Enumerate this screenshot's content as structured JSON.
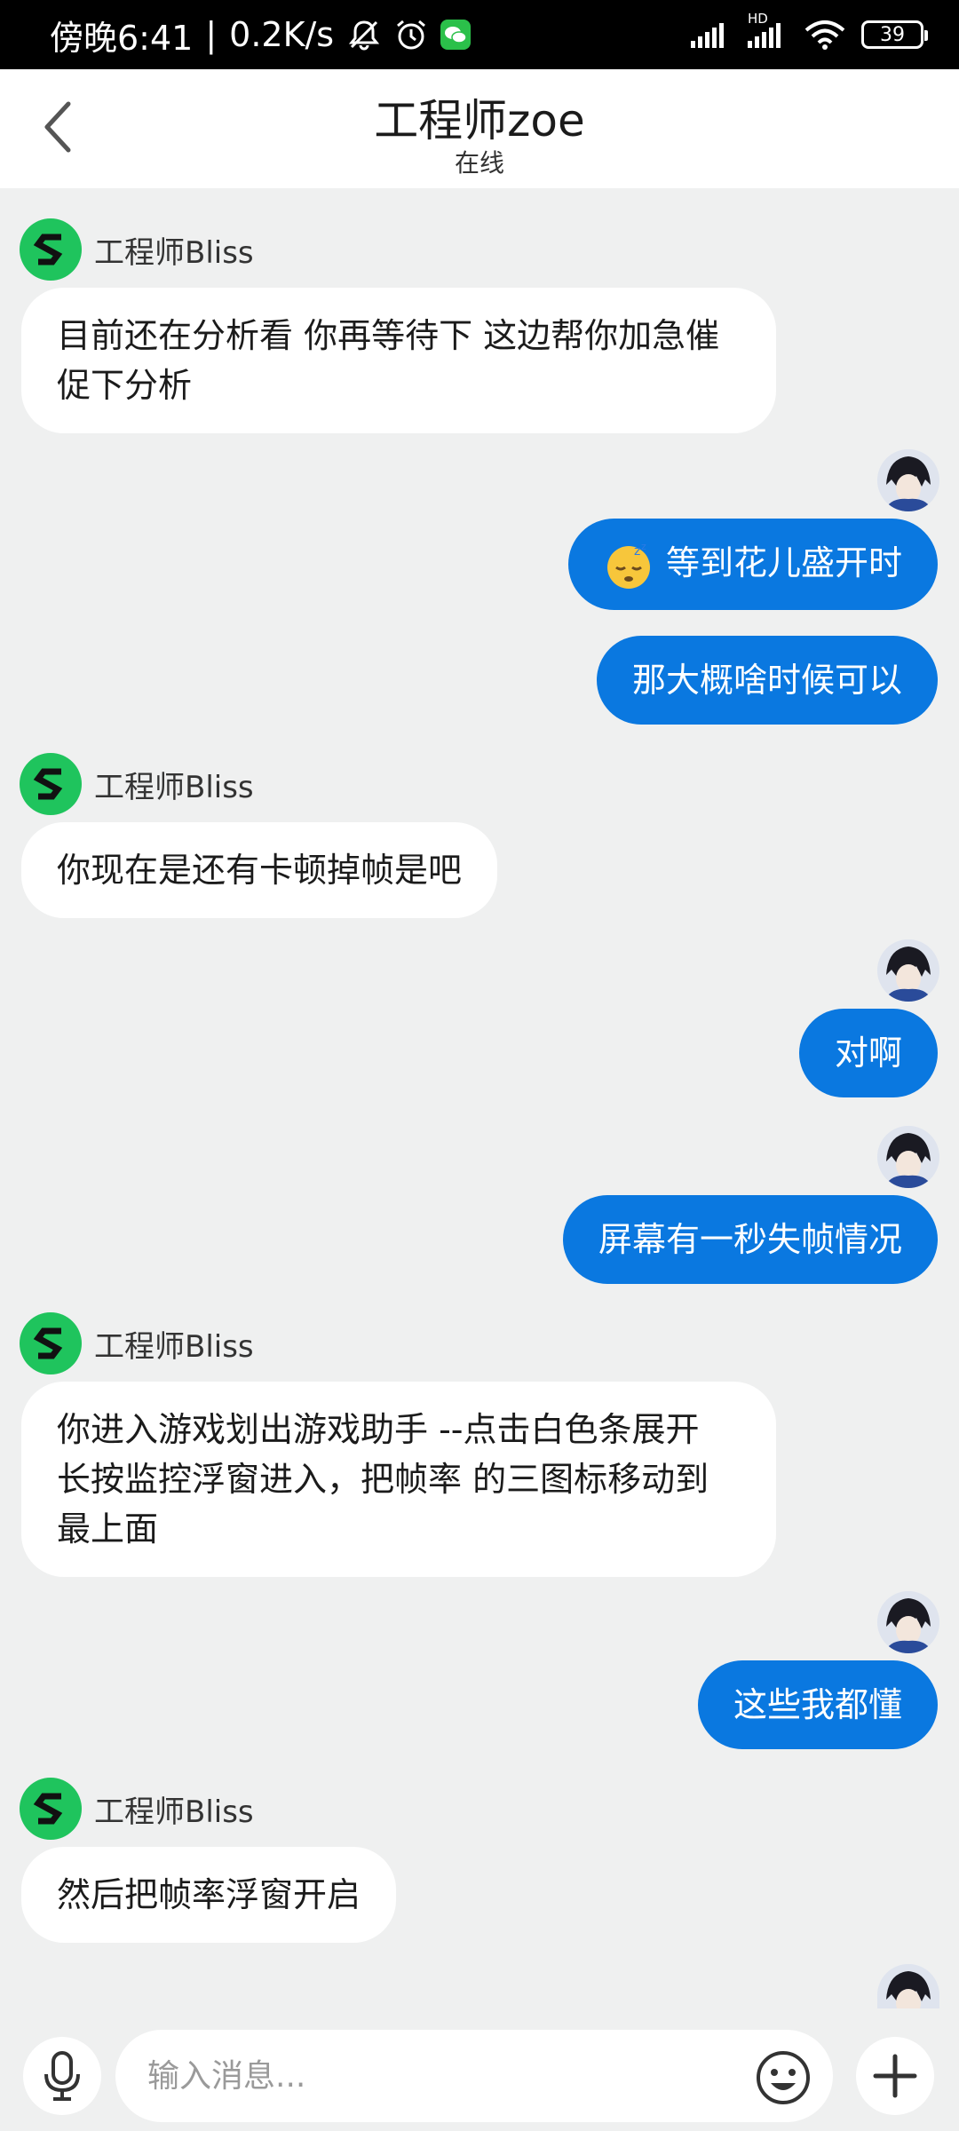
{
  "status_bar": {
    "time": "傍晚6:41",
    "separator": "|",
    "net_speed": "0.2K/s",
    "battery": "39",
    "hd_label": "HD",
    "icons": [
      "mute-bell-icon",
      "alarm-icon",
      "wechat-icon",
      "signal-icon",
      "signal-hd-icon",
      "wifi-icon",
      "battery-icon"
    ]
  },
  "header": {
    "title": "工程师zoe",
    "subtitle": "在线",
    "back_icon": "chevron-left-icon"
  },
  "messages": [
    {
      "from": "agent",
      "sender": "工程师Bliss",
      "text": "目前还在分析看 你再等待下 这边帮你加急催促下分析"
    },
    {
      "from": "user",
      "emoji": "sleeping-face-emoji",
      "text": "等到花儿盛开时"
    },
    {
      "from": "user",
      "text": "那大概啥时候可以"
    },
    {
      "from": "agent",
      "sender": "工程师Bliss",
      "text": "你现在是还有卡顿掉帧是吧"
    },
    {
      "from": "user",
      "text": "对啊"
    },
    {
      "from": "user",
      "text": "屏幕有一秒失帧情况"
    },
    {
      "from": "agent",
      "sender": "工程师Bliss",
      "text": "你进入游戏划出游戏助手 --点击白色条展开 长按监控浮窗进入，把帧率 的三图标移动到最上面"
    },
    {
      "from": "user",
      "text": "这些我都懂"
    },
    {
      "from": "agent",
      "sender": "工程师Bliss",
      "text": "然后把帧率浮窗开启"
    }
  ],
  "input_bar": {
    "placeholder": "输入消息...",
    "icons": [
      "microphone-icon",
      "emoji-icon",
      "plus-icon"
    ]
  },
  "colors": {
    "user_bubble": "#0a78e0",
    "agent_bubble": "#ffffff",
    "agent_avatar": "#1fc45d",
    "background": "#eff0f0"
  }
}
